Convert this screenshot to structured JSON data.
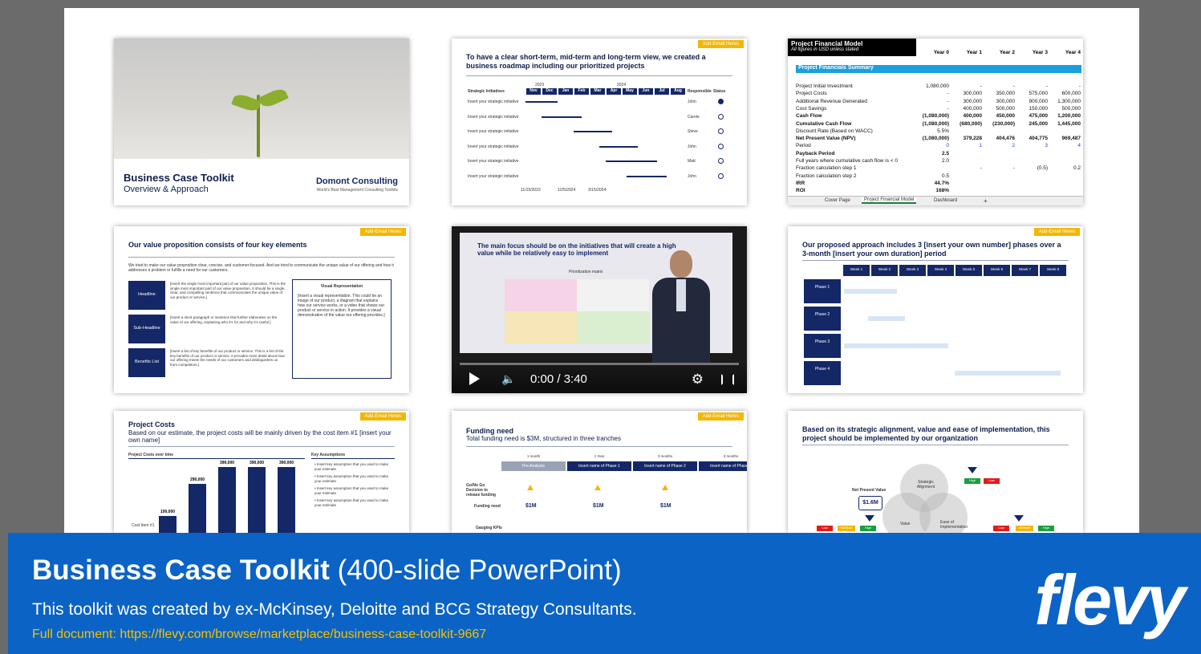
{
  "thumb1": {
    "title": "Business Case Toolkit",
    "subtitle": "Overview & Approach",
    "brand": "Domont Consulting",
    "brand_tagline": "World's Best Management Consulting Toolkits"
  },
  "thumb2": {
    "tag": "Add-Email Heres",
    "title": "To have a clear short-term, mid-term and long-term view, we created a business roadmap including our prioritized projects",
    "col_initiatives": "Strategic Initiatives",
    "years": [
      "2023",
      "2024"
    ],
    "months": [
      "Nov",
      "Dec",
      "Jan",
      "Feb",
      "Mar",
      "Apr",
      "May",
      "Jun",
      "Jul",
      "Aug"
    ],
    "col_responsible": "Responsible",
    "col_status": "Status",
    "rows": [
      {
        "label": "Insert your strategic initiative",
        "owner": "John"
      },
      {
        "label": "Insert your strategic initiative",
        "owner": "Carole"
      },
      {
        "label": "Insert your strategic initiative",
        "owner": "Steve"
      },
      {
        "label": "Insert your strategic initiative",
        "owner": "John"
      },
      {
        "label": "Insert your strategic initiative",
        "owner": "Matt"
      },
      {
        "label": "Insert your strategic initiative",
        "owner": "John"
      }
    ],
    "dates": [
      "11/15/2023",
      "1/25/2024",
      "3/15/2024"
    ]
  },
  "thumb3": {
    "header": "Project Financial Model",
    "header_note": "All figures in USD unless stated",
    "years": [
      "Year 0",
      "Year 1",
      "Year 2",
      "Year 3",
      "Year 4"
    ],
    "section": "Project Financials Summary",
    "rows": [
      {
        "label": "Project Initial Investment",
        "v": [
          "1,080,000",
          "-",
          "-",
          "-",
          "-"
        ]
      },
      {
        "label": "Project Costs",
        "v": [
          "-",
          "300,000",
          "350,000",
          "575,000",
          "600,000"
        ]
      },
      {
        "label": "Additional Revenue Generated",
        "v": [
          "-",
          "300,000",
          "300,000",
          "900,000",
          "1,300,000"
        ]
      },
      {
        "label": "Cost Savings",
        "v": [
          "-",
          "400,000",
          "500,000",
          "150,000",
          "500,000"
        ]
      },
      {
        "label": "Cash Flow",
        "v": [
          "(1,080,000)",
          "400,000",
          "450,000",
          "475,000",
          "1,200,000"
        ]
      },
      {
        "label": "Cumulative Cash Flow",
        "v": [
          "(1,080,000)",
          "(680,000)",
          "(230,000)",
          "245,000",
          "1,445,000"
        ]
      },
      {
        "label": "Discount Rate (Based on WACC)",
        "v": [
          "5.5%",
          "",
          "",
          "",
          ""
        ]
      },
      {
        "label": "Net Present Value (NPV)",
        "v": [
          "(1,080,000)",
          "379,228",
          "404,476",
          "404,775",
          "969,487"
        ]
      },
      {
        "label": "Period",
        "v": [
          "0",
          "1",
          "2",
          "3",
          "4"
        ]
      },
      {
        "label": "Payback Period",
        "v": [
          "2.5",
          "",
          "",
          "",
          ""
        ]
      },
      {
        "label": "Full years where cumulative cash flow is < 0",
        "v": [
          "2.0",
          "",
          "",
          "",
          ""
        ]
      },
      {
        "label": "Fraction calculation step 1",
        "v": [
          "",
          "-",
          "-",
          "(0.5)",
          "0.2"
        ]
      },
      {
        "label": "Fraction calculation step 2",
        "v": [
          "0.5",
          "",
          "",
          "",
          ""
        ]
      },
      {
        "label": "IRR",
        "v": [
          "44.7%",
          "",
          "",
          "",
          ""
        ]
      },
      {
        "label": "ROI",
        "v": [
          "168%",
          "",
          "",
          "",
          ""
        ]
      }
    ],
    "tabs": [
      "Cover Page",
      "Project Financial Model",
      "Dashboard",
      "+"
    ]
  },
  "thumb4": {
    "tag": "Add-Email Heres",
    "title": "Our value proposition consists of four key elements",
    "intro": "We tried to make our value proposition clear, concise, and customer-focused. And we tried to communicate the unique value of our offering and how it addresses a problem or fulfills a need for our customers.",
    "rows": [
      {
        "label": "Headline",
        "text": "[Insert the single most important part of our value proposition. This is the single most important part of our value proposition. It should be a single, clear, and compelling sentence that communicates the unique value of our product or service.]"
      },
      {
        "label": "Sub-Headline",
        "text": "[Insert a short paragraph or sentence that further elaborates on the value of our offering, explaining who it's for and why it's useful.]"
      },
      {
        "label": "Benefits List",
        "text": "[Insert a list of key benefits of our product or service. This is a list of the key benefits of our product or service. It provides more detail about how our offering meets the needs of our customers and distinguishes us from competitors.]"
      }
    ],
    "visual_title": "Visual Representation",
    "visual_text": "[Insert a visual representation. This could be an image of our product, a diagram that explains how our service works, or a video that shows our product or service in action. It provides a visual demonstration of the value our offering provides.]"
  },
  "thumb5": {
    "slide_title": "The main focus should be on the initiatives that will create a high value while be relatively easy to implement",
    "matrix_title": "Prioritization matrix",
    "time": "0:00 / 3:40"
  },
  "thumb6": {
    "tag": "Add-Email Heres",
    "title": "Our proposed approach includes 3 [insert your own number] phases over a 3-month [insert your own duration] period",
    "weeks": [
      "Week 1",
      "Week 2",
      "Week 3",
      "Week 4",
      "Week 5",
      "Week 6",
      "Week 7",
      "Week 8"
    ],
    "phases": [
      "Phase 1",
      "Phase 2",
      "Phase 3",
      "Phase 4"
    ]
  },
  "thumb7": {
    "tag": "Add-Email Heres",
    "title": "Project Costs",
    "subtitle": "Based on our estimate, the project costs will be mainly driven by the cost item #1 [insert your own name]",
    "chart_title": "Project Costs over time",
    "assumptions_title": "Key Assumptions",
    "assumptions": [
      "Insert key assumption that you used to make your estimate",
      "Insert key assumption that you used to make your estimate",
      "Insert key assumption that you used to make your estimate",
      "Insert key assumption that you used to make your estimate"
    ],
    "row_label": "Cost Item #1"
  },
  "thumb8": {
    "tag": "Add-Email Heres",
    "title": "Funding need",
    "subtitle": "Total funding need is $3M, structured in three tranches",
    "durations": [
      "1 month",
      "1 Year",
      "3 months",
      "3 months"
    ],
    "stages": [
      "Pre-Analysis",
      "Insert name of Phase 1",
      "Insert name of Phase 2",
      "Insert name of Phase 3"
    ],
    "row1": "Go/No Go Decision to release funding",
    "row2": "Funding need",
    "row3": "Gauging KPIs",
    "amounts": [
      "$1M",
      "$1M",
      "$1M"
    ]
  },
  "thumb9": {
    "title": "Based on its strategic alignment, value and ease of implementation, this project should be implemented by our organization",
    "npv_label": "Net Present Value",
    "npv_value": "$1.6M",
    "circles": [
      "Strategic Alignment",
      "Value",
      "Ease of Implementation"
    ],
    "levels": [
      "Low",
      "Medium",
      "High"
    ]
  },
  "footer": {
    "title_bold": "Business Case Toolkit",
    "title_rest": " (400-slide PowerPoint)",
    "description": "This toolkit was created by ex-McKinsey, Deloitte and BCG Strategy Consultants.",
    "link": "Full document: https://flevy.com/browse/marketplace/business-case-toolkit-9667",
    "logo": "flevy"
  },
  "colors": {
    "navy": "#142766",
    "footer_blue": "#0b63c5",
    "link_yellow": "#f2c100",
    "tag_yellow": "#f2b705",
    "excel_blue": "#1aa0dc"
  }
}
